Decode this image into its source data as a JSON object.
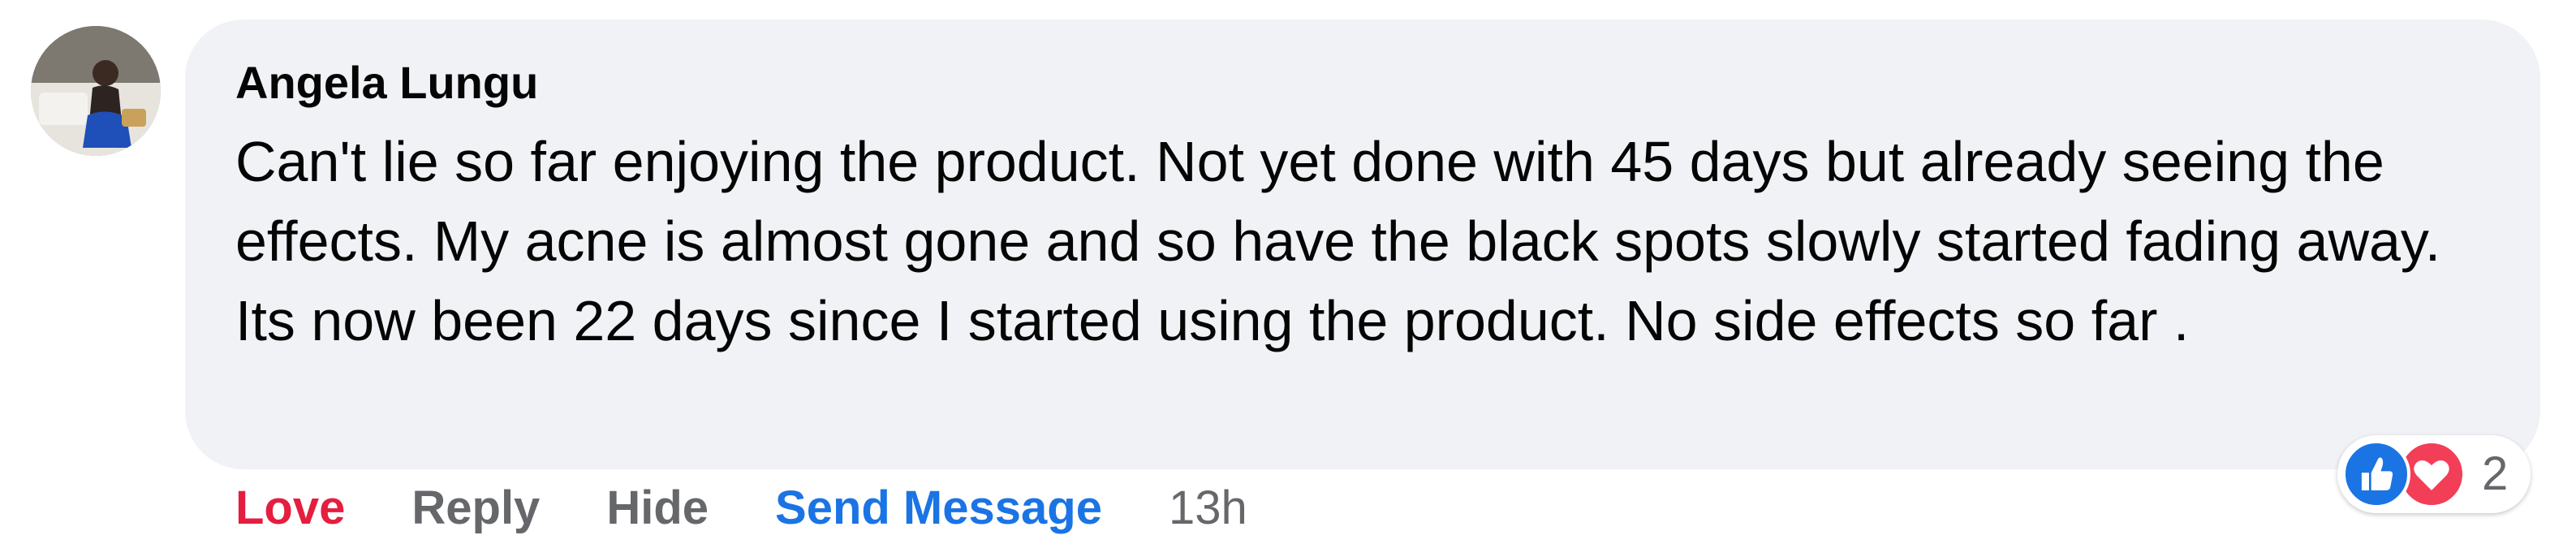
{
  "comment": {
    "author": "Angela Lungu",
    "text": "Can't lie so far enjoying the product. Not yet done with 45 days but already seeing the effects. My acne is almost gone and so have the black spots slowly started fading away. Its now been 22 days since I started using the product. No side effects so far ."
  },
  "actions": {
    "love": "Love",
    "reply": "Reply",
    "hide": "Hide",
    "send_message": "Send Message",
    "timestamp": "13h"
  },
  "reactions": {
    "icons": [
      "like-icon",
      "heart-icon"
    ],
    "count": "2"
  },
  "colors": {
    "bubble": "#f0f2f5",
    "love": "#e41e3f",
    "link_blue": "#1b74e4",
    "secondary_text": "#65676b",
    "like_reaction": "#1b74e4",
    "love_reaction": "#f33e58"
  }
}
